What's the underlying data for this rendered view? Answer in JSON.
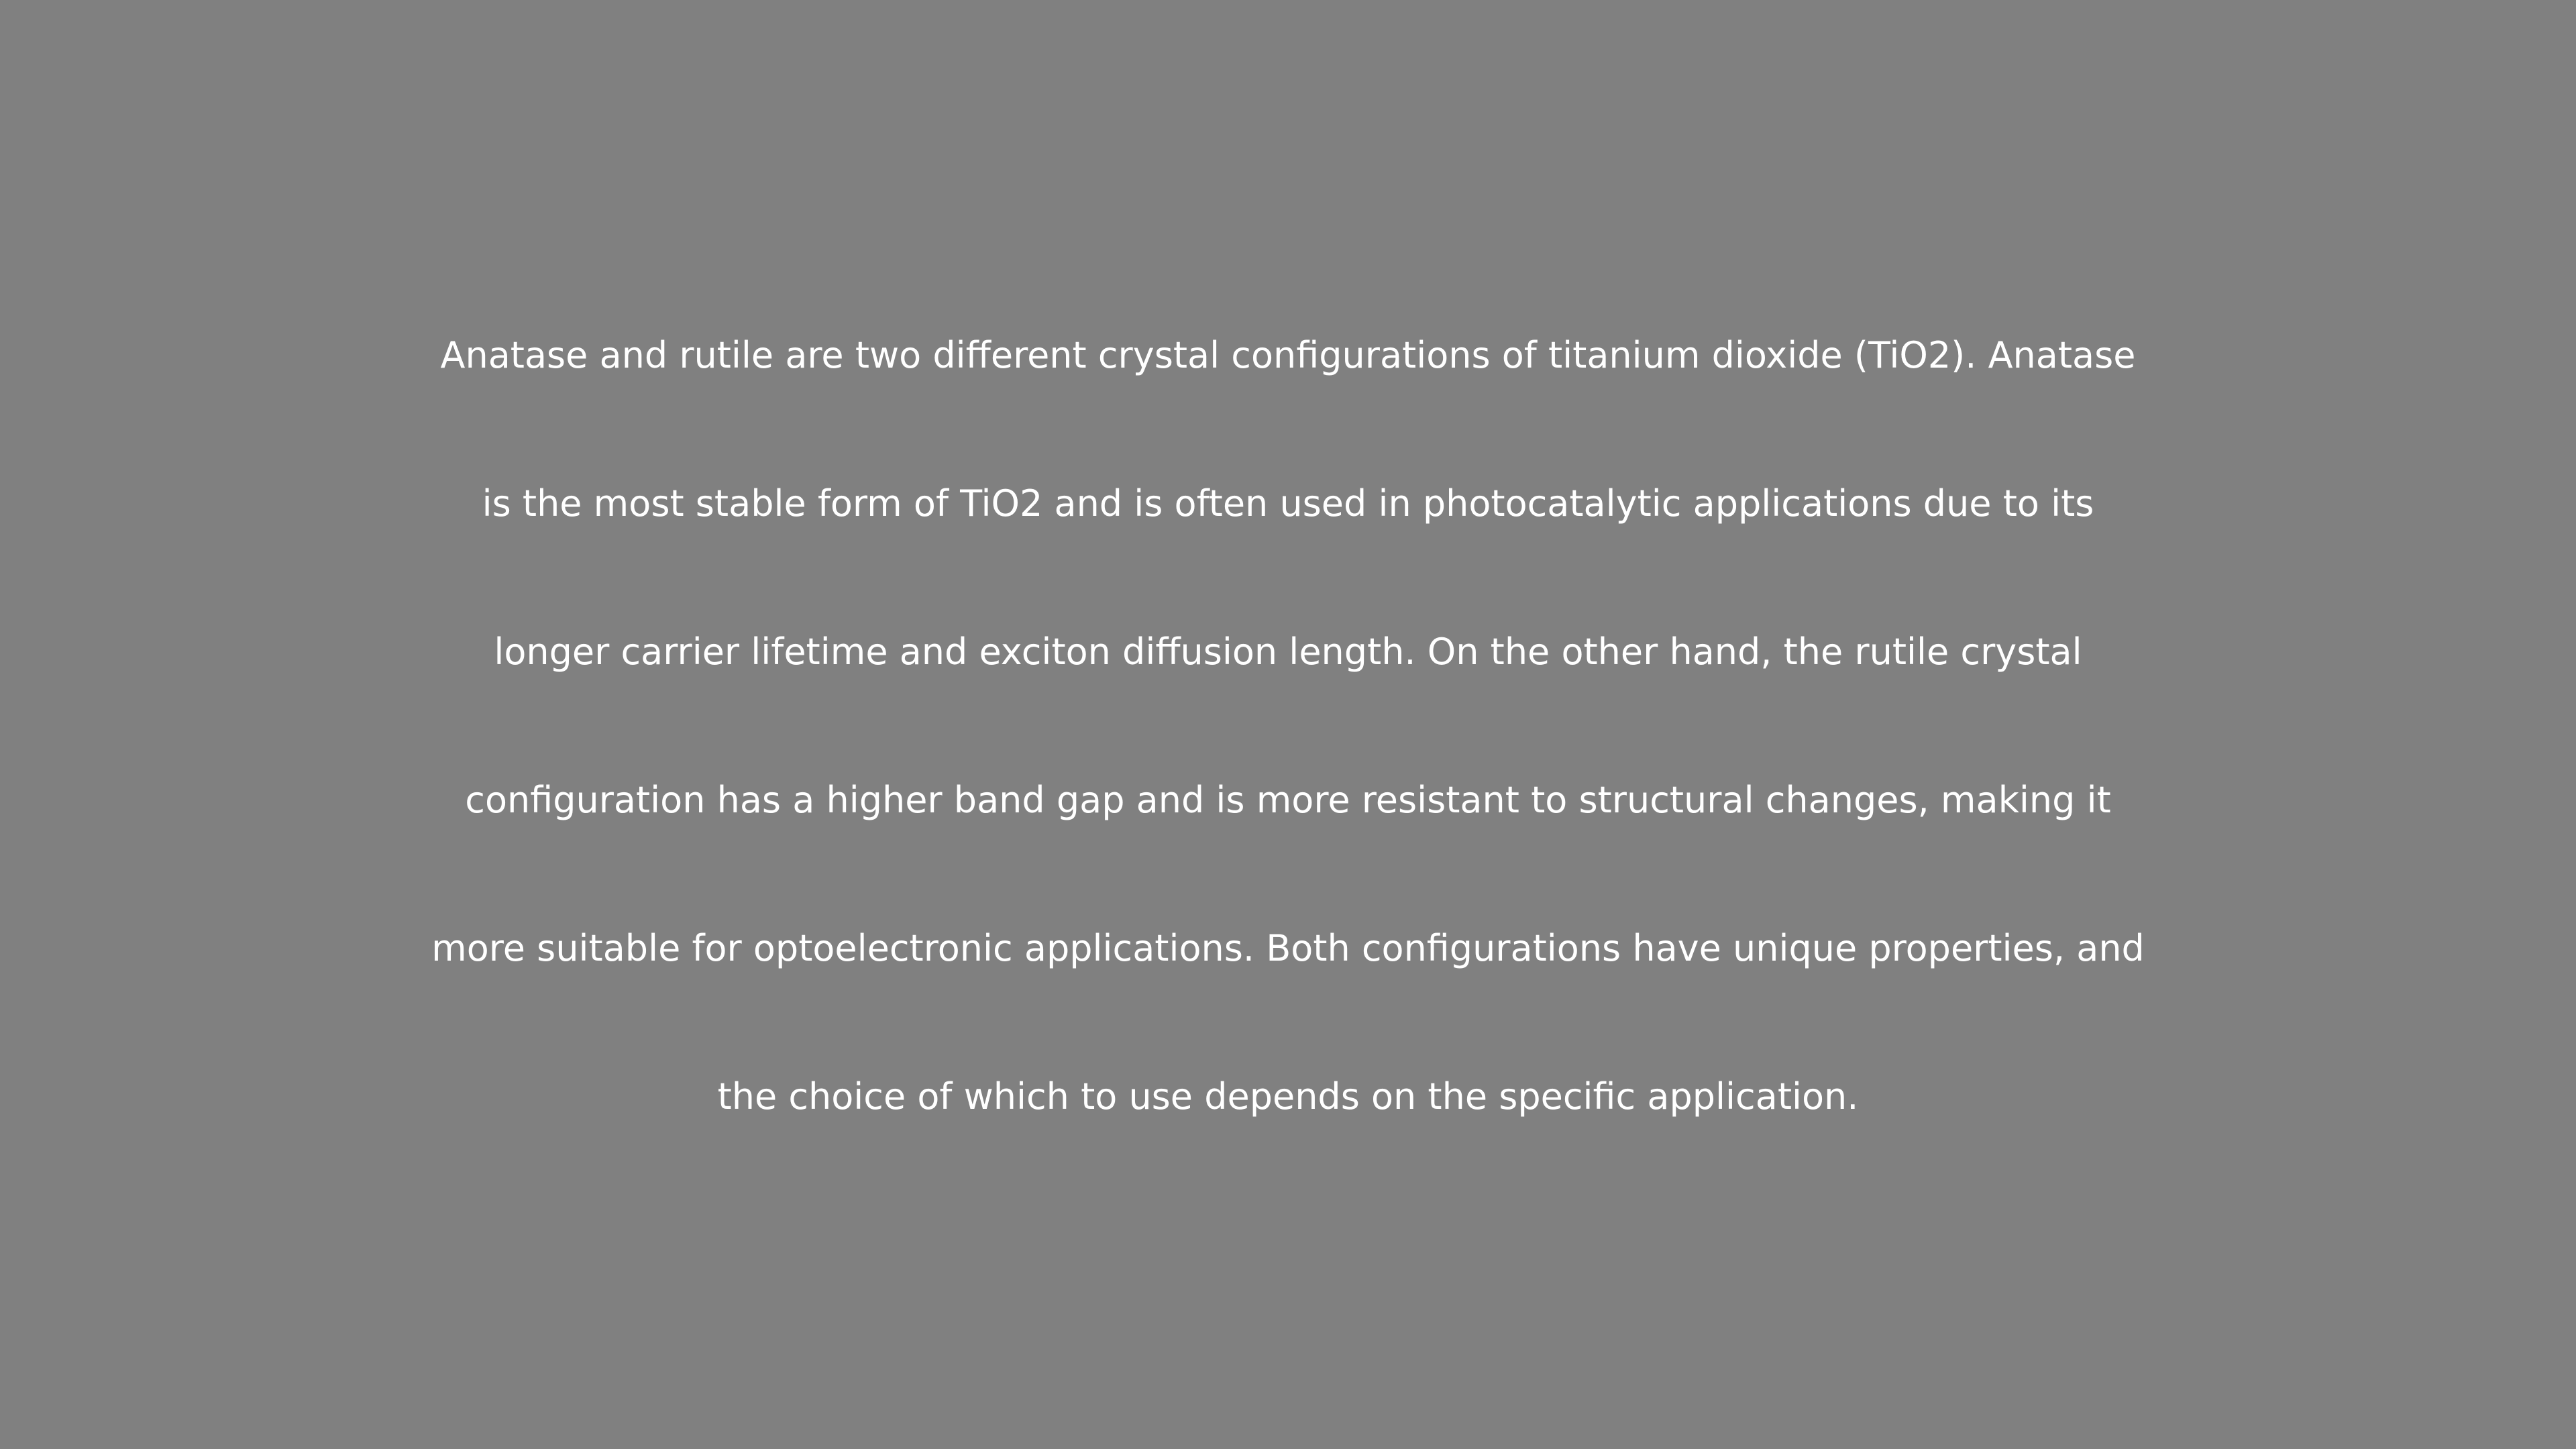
{
  "paragraph": {
    "lines": [
      "Anatase and rutile are two different crystal configurations of titanium dioxide (TiO2). Anatase",
      "is the most stable form of TiO2 and is often used in photocatalytic applications due to its",
      "longer carrier lifetime and exciton diffusion length. On the other hand, the rutile crystal",
      "configuration has a higher band gap and is more resistant to structural changes, making it",
      "more suitable for optoelectronic applications. Both configurations have unique properties, and",
      "the choice of which to use depends on the specific application."
    ]
  },
  "colors": {
    "background": "#808080",
    "text": "#ffffff"
  }
}
